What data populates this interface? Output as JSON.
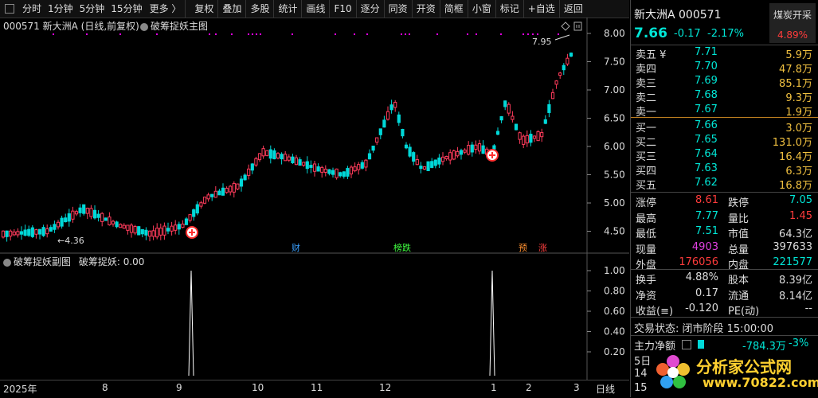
{
  "toolbar": {
    "left_items": [
      "分时",
      "1分钟",
      "5分钟",
      "15分钟",
      "更多 〉"
    ],
    "items": [
      "复权",
      "叠加",
      "多股",
      "统计",
      "画线",
      "F10",
      "逐分",
      "同资",
      "开资",
      "简框",
      "小窗",
      "标记",
      "+自选",
      "返回"
    ]
  },
  "chart": {
    "stock_label": "000571 新大洲A (日线,前复权)",
    "main_indicator": "破筹捉妖主图",
    "sub_indicator": "破筹捉妖副图",
    "sub_value_label": "破筹捉妖: 0.00",
    "high_marker": "7.95",
    "low_marker": "←4.36",
    "price_axis": [
      "8.00",
      "7.50",
      "7.00",
      "6.50",
      "6.00",
      "5.50",
      "5.00",
      "4.50"
    ],
    "sub_axis": [
      "1.00",
      "0.80",
      "0.60",
      "0.40",
      "0.20"
    ],
    "date_axis": [
      "2025年",
      "8",
      "9",
      "10",
      "11",
      "12",
      "1",
      "2",
      "3",
      "日线"
    ],
    "tags": [
      {
        "text": "财",
        "color": "#3aa0ff"
      },
      {
        "text": "榜跌",
        "color": "#40ff40"
      },
      {
        "text": "预",
        "color": "#ff9030"
      },
      {
        "text": "涨",
        "color": "#ff4040"
      }
    ],
    "colors": {
      "up": "#ff3b5b",
      "down": "#00d8d8",
      "grid": "#333333",
      "magenta": "#e000e0"
    }
  },
  "panel": {
    "title": "新大洲A 000571",
    "badge": "煤炭开采",
    "badge_pct": "4.89%",
    "price": "7.66",
    "change": "-0.17",
    "change_pct": "-2.17%",
    "sells": [
      {
        "label": "卖五 ¥",
        "price": "7.71",
        "vol": "5.9万"
      },
      {
        "label": "卖四",
        "price": "7.70",
        "vol": "47.8万"
      },
      {
        "label": "卖三",
        "price": "7.69",
        "vol": "85.1万"
      },
      {
        "label": "卖二",
        "price": "7.68",
        "vol": "9.3万"
      },
      {
        "label": "卖一",
        "price": "7.67",
        "vol": "1.9万"
      }
    ],
    "buys": [
      {
        "label": "买一",
        "price": "7.66",
        "vol": "3.0万"
      },
      {
        "label": "买二",
        "price": "7.65",
        "vol": "131.0万"
      },
      {
        "label": "买三",
        "price": "7.64",
        "vol": "16.4万"
      },
      {
        "label": "买四",
        "price": "7.63",
        "vol": "6.3万"
      },
      {
        "label": "买五",
        "price": "7.62",
        "vol": "16.8万"
      }
    ],
    "stats": [
      {
        "l1": "涨停",
        "v1": "8.61",
        "c1": "red",
        "l2": "跌停",
        "v2": "7.05",
        "c2": "green"
      },
      {
        "l1": "最高",
        "v1": "7.77",
        "c1": "green",
        "l2": "量比",
        "v2": "1.45",
        "c2": "red"
      },
      {
        "l1": "最低",
        "v1": "7.51",
        "c1": "green",
        "l2": "市值",
        "v2": "64.3亿",
        "c2": "white"
      },
      {
        "l1": "现量",
        "v1": "4903",
        "c1": "magenta",
        "l2": "总量",
        "v2": "397633",
        "c2": "white"
      },
      {
        "l1": "外盘",
        "v1": "176056",
        "c1": "red",
        "l2": "内盘",
        "v2": "221577",
        "c2": "green"
      }
    ],
    "stats2": [
      {
        "l1": "换手",
        "v1": "4.88%",
        "c1": "white",
        "l2": "股本",
        "v2": "8.39亿",
        "c2": "white"
      },
      {
        "l1": "净资",
        "v1": "0.17",
        "c1": "white",
        "l2": "流通",
        "v2": "8.14亿",
        "c2": "white"
      },
      {
        "l1": "收益(≡)",
        "v1": "-0.120",
        "c1": "white",
        "l2": "PE(动)",
        "v2": "--",
        "c2": "white"
      }
    ],
    "status": "交易状态: 闭市阶段 15:00:00",
    "net_flow_label": "主力净额",
    "net_flow": "-784.3万",
    "net_flow_pct": "-3%",
    "bottom_lines": [
      "5日",
      "14",
      "15"
    ]
  },
  "watermark": {
    "text": "www.70822.com 分析家公式网",
    "logo_text": "分析家公式网",
    "logo_url": "www.70822.com"
  }
}
